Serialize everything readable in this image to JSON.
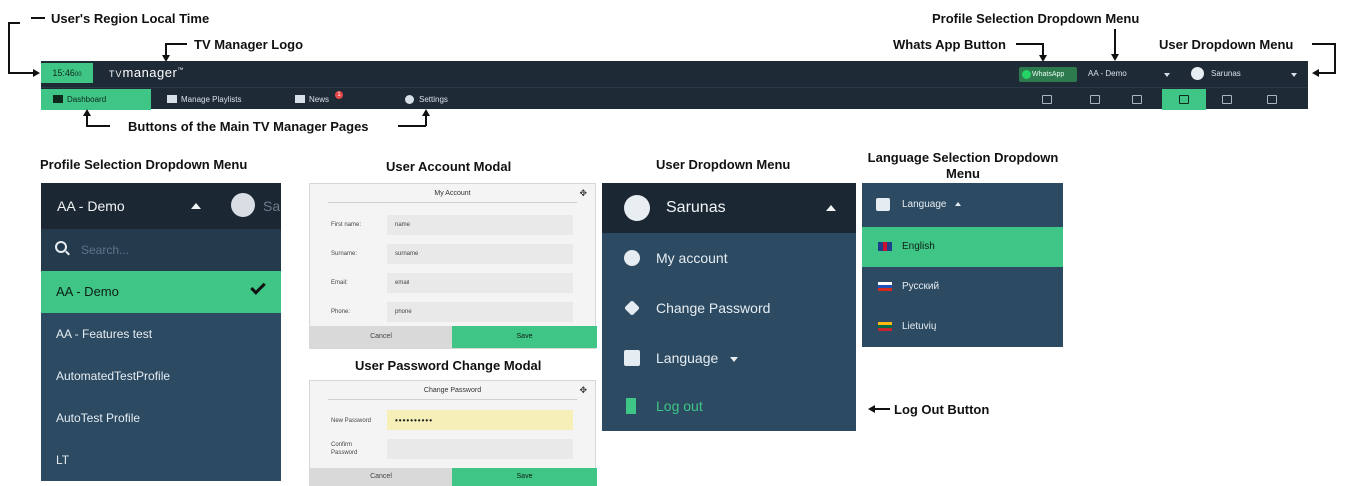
{
  "annotations": {
    "local_time": "User's Region Local Time",
    "logo": "TV Manager Logo",
    "profile_dropdown_top": "Profile Selection Dropdown Menu",
    "whatsapp": "Whats App Button",
    "user_dropdown_top": "User  Dropdown Menu",
    "main_pages": "Buttons of the Main TV Manager Pages",
    "log_out": "Log Out Button"
  },
  "headings": {
    "profile_dropdown": "Profile Selection Dropdown Menu",
    "user_account_modal": "User Account Modal",
    "user_dropdown": "User  Dropdown Menu",
    "language_dropdown": "Language Selection Dropdown Menu",
    "password_modal": "User Password Change Modal"
  },
  "topbar": {
    "time": "15:46",
    "time_suffix": "00",
    "logo_tv": "TV",
    "logo_text": "manager",
    "whatsapp_label": "WhatsApp",
    "profile": "AA - Demo",
    "user": "Sarunas",
    "colors": {
      "bar": "#1e2a36",
      "accent": "#3fc585"
    }
  },
  "nav": {
    "tabs": [
      {
        "label": "Dashboard",
        "icon": "dashboard-icon",
        "active": true
      },
      {
        "label": "Manage Playlists",
        "icon": "playlist-icon",
        "active": false
      },
      {
        "label": "News",
        "icon": "mail-icon",
        "active": false,
        "badge": "1"
      },
      {
        "label": "Settings",
        "icon": "gear-icon",
        "active": false
      }
    ],
    "right_icons": [
      "message-icon",
      "image-icon",
      "play-icon",
      "device-icon",
      "export-icon",
      "playlist-play-icon"
    ]
  },
  "profile_dropdown": {
    "current": "AA - Demo",
    "user_initials": "Sa",
    "search_placeholder": "Search...",
    "items": [
      {
        "label": "AA - Demo",
        "selected": true
      },
      {
        "label": "AA - Features test",
        "selected": false
      },
      {
        "label": "AutomatedTestProfile",
        "selected": false
      },
      {
        "label": "AutoTest Profile",
        "selected": false
      },
      {
        "label": "LT",
        "selected": false
      }
    ]
  },
  "account_modal": {
    "title": "My Account",
    "fields": [
      {
        "label": "First name:",
        "value": "name"
      },
      {
        "label": "Surname:",
        "value": "surname"
      },
      {
        "label": "Email:",
        "value": "email"
      },
      {
        "label": "Phone:",
        "value": "phone"
      }
    ],
    "cancel": "Cancel",
    "save": "Save"
  },
  "password_modal": {
    "title": "Change Password",
    "new_label": "New Password",
    "new_value": "••••••••••",
    "confirm_label": "Confirm Password",
    "cancel": "Cancel",
    "save": "Save"
  },
  "user_dropdown": {
    "name": "Sarunas",
    "items": [
      {
        "label": "My account",
        "icon": "user-icon"
      },
      {
        "label": "Change Password",
        "icon": "key-icon"
      },
      {
        "label": "Language",
        "icon": "translate-icon"
      },
      {
        "label": "Log out",
        "icon": "logout-icon"
      }
    ]
  },
  "language_dropdown": {
    "header": "Language",
    "items": [
      {
        "label": "English",
        "selected": true,
        "flag": "uk"
      },
      {
        "label": "Русский",
        "selected": false,
        "flag": "ru"
      },
      {
        "label": "Lietuvių",
        "selected": false,
        "flag": "lt"
      }
    ]
  }
}
